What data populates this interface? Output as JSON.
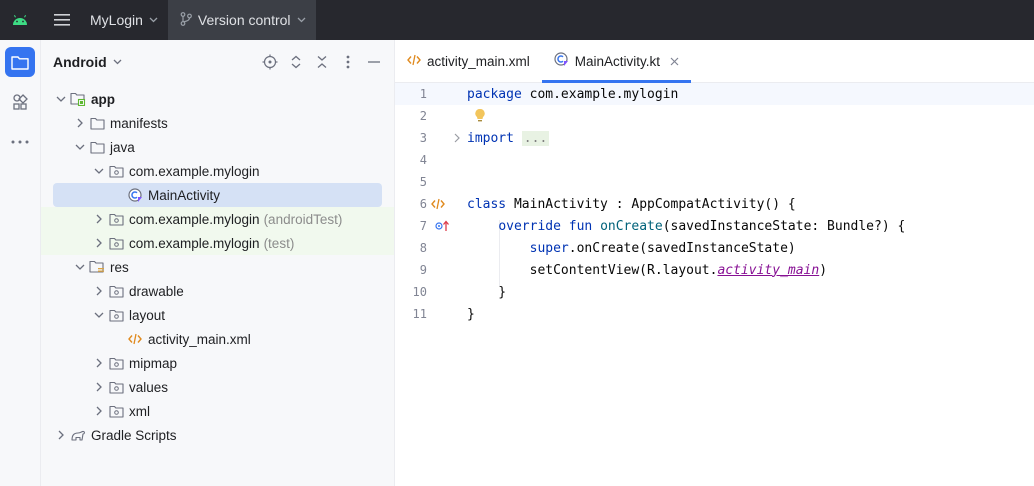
{
  "titlebar": {
    "project_name": "MyLogin",
    "vcs_label": "Version control"
  },
  "toolstrip": {
    "icons": [
      "project-icon",
      "structure-icon",
      "more-icon"
    ]
  },
  "panel": {
    "title": "Android"
  },
  "tree": [
    {
      "label": "app",
      "hint": "",
      "level": 0,
      "expanded": true,
      "icon": "module-folder-icon",
      "bold": true
    },
    {
      "label": "manifests",
      "hint": "",
      "level": 1,
      "expanded": false,
      "icon": "folder-icon"
    },
    {
      "label": "java",
      "hint": "",
      "level": 1,
      "expanded": true,
      "icon": "folder-icon"
    },
    {
      "label": "com.example.mylogin",
      "hint": "",
      "level": 2,
      "expanded": true,
      "icon": "package-icon"
    },
    {
      "label": "MainActivity",
      "hint": "",
      "level": 3,
      "icon": "kotlin-class-icon",
      "selected": true
    },
    {
      "label": "com.example.mylogin",
      "hint": "(androidTest)",
      "level": 2,
      "expanded": false,
      "icon": "package-icon",
      "tinted": true
    },
    {
      "label": "com.example.mylogin",
      "hint": "(test)",
      "level": 2,
      "expanded": false,
      "icon": "package-icon",
      "tinted": true
    },
    {
      "label": "res",
      "hint": "",
      "level": 1,
      "expanded": true,
      "icon": "resource-folder-icon"
    },
    {
      "label": "drawable",
      "hint": "",
      "level": 2,
      "expanded": false,
      "icon": "package-icon"
    },
    {
      "label": "layout",
      "hint": "",
      "level": 2,
      "expanded": true,
      "icon": "package-icon"
    },
    {
      "label": "activity_main.xml",
      "hint": "",
      "level": 3,
      "icon": "xml-file-icon"
    },
    {
      "label": "mipmap",
      "hint": "",
      "level": 2,
      "expanded": false,
      "icon": "package-icon"
    },
    {
      "label": "values",
      "hint": "",
      "level": 2,
      "expanded": false,
      "icon": "package-icon"
    },
    {
      "label": "xml",
      "hint": "",
      "level": 2,
      "expanded": false,
      "icon": "package-icon"
    },
    {
      "label": "Gradle Scripts",
      "hint": "",
      "level": 0,
      "expanded": false,
      "icon": "gradle-icon"
    }
  ],
  "tabs": [
    {
      "label": "activity_main.xml",
      "icon": "xml-file-icon",
      "active": false
    },
    {
      "label": "MainActivity.kt",
      "icon": "kotlin-class-icon",
      "active": true
    }
  ],
  "code": {
    "lines": [
      {
        "n": "1",
        "tokens": [
          [
            "kw",
            "package"
          ],
          [
            "",
            " com.example.mylogin"
          ]
        ]
      },
      {
        "n": "2",
        "tokens": []
      },
      {
        "n": "3",
        "tokens": [
          [
            "kw",
            "import"
          ],
          [
            "",
            " "
          ],
          [
            "fold",
            "..."
          ]
        ]
      },
      {
        "n": "4",
        "tokens": []
      },
      {
        "n": "5",
        "tokens": []
      },
      {
        "n": "6",
        "tokens": [
          [
            "kw",
            "class"
          ],
          [
            "",
            " MainActivity : AppCompatActivity() {"
          ]
        ]
      },
      {
        "n": "7",
        "tokens": [
          [
            "",
            "    "
          ],
          [
            "kw",
            "override fun"
          ],
          [
            "",
            " "
          ],
          [
            "fn",
            "onCreate"
          ],
          [
            "",
            "(savedInstanceState: Bundle?) {"
          ]
        ]
      },
      {
        "n": "8",
        "tokens": [
          [
            "",
            "        "
          ],
          [
            "kw",
            "super"
          ],
          [
            "",
            ".onCreate(savedInstanceState)"
          ]
        ]
      },
      {
        "n": "9",
        "tokens": [
          [
            "",
            "        setContentView(R.layout."
          ],
          [
            "res",
            "activity_main"
          ],
          [
            "",
            ")"
          ]
        ]
      },
      {
        "n": "10",
        "tokens": [
          [
            "",
            "    }"
          ]
        ]
      },
      {
        "n": "11",
        "tokens": [
          [
            "",
            "}"
          ]
        ]
      }
    ]
  },
  "colors": {
    "accent": "#3574f0",
    "keyword": "#0033b3",
    "function": "#00627a",
    "resource": "#871094"
  }
}
